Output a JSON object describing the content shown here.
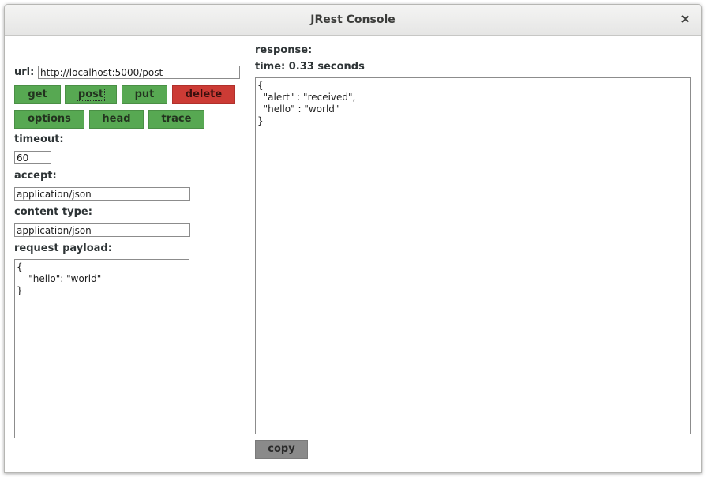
{
  "window": {
    "title": "JRest Console",
    "close_glyph": "×"
  },
  "request": {
    "url_label": "url:",
    "url_value": "http://localhost:5000/post",
    "methods": {
      "get": "get",
      "post": "post",
      "put": "put",
      "delete": "delete",
      "options": "options",
      "head": "head",
      "trace": "trace"
    },
    "timeout_label": "timeout:",
    "timeout_value": "60",
    "accept_label": "accept:",
    "accept_value": "application/json",
    "content_type_label": "content type:",
    "content_type_value": "application/json",
    "payload_label": "request payload:",
    "payload_value": "{\n    \"hello\": \"world\"\n}"
  },
  "response": {
    "label": "response:",
    "time_text": "time: 0.33 seconds",
    "body": "{\n  \"alert\" : \"received\",\n  \"hello\" : \"world\"\n}",
    "copy_label": "copy"
  },
  "colors": {
    "button_green": "#57a852",
    "button_red": "#cc3b35",
    "button_gray": "#8a8a8a"
  }
}
